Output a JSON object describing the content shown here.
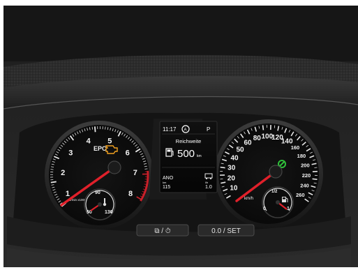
{
  "display": {
    "time": "11:17",
    "gear": "P",
    "title": "Reichweite",
    "range_value": "500",
    "range_unit": "km",
    "ano_label": "ANO",
    "ano_value": "115",
    "ano_unit": "km",
    "consumption_label": "l/h",
    "consumption_value": "1.0"
  },
  "tachometer": {
    "numbers": [
      "1",
      "2",
      "3",
      "4",
      "5",
      "6",
      "7",
      "8"
    ],
    "needle_value": 0,
    "epc_label": "EPC",
    "temp_sub_numbers": [
      "50",
      "90",
      "130"
    ],
    "subunit": "1/min x1000"
  },
  "speedometer": {
    "numbers": [
      "10",
      "20",
      "30",
      "40",
      "50",
      "60",
      "80",
      "100",
      "120",
      "140",
      "160",
      "180",
      "200",
      "220",
      "240",
      "260"
    ],
    "unit": "km/h",
    "needle_value": 0,
    "fuel_sub_numbers": [
      "0",
      "1/2",
      "1"
    ]
  },
  "buttons": {
    "left_label": "⧉ / ⏱",
    "right_label": "0.0 / SET"
  },
  "colors": {
    "needle": "#e0202a",
    "epc": "#f0a020",
    "engine_warning": "#f0a020",
    "seatbelt": "#e8382a",
    "cruise_indicator": "#2fbf3a",
    "redline": "#c8202a"
  }
}
